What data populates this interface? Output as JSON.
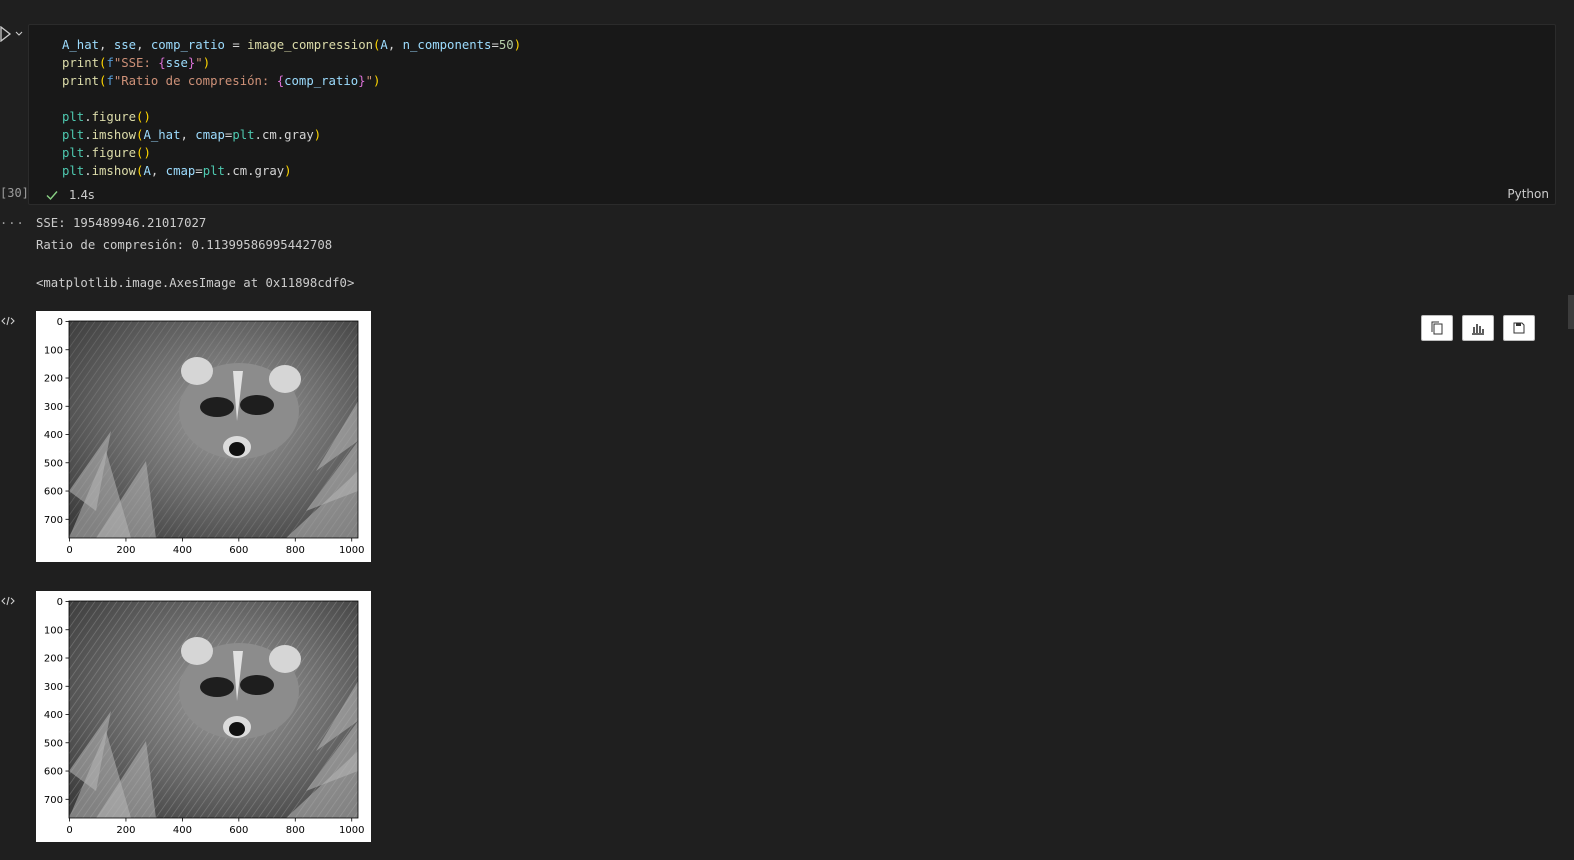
{
  "cell": {
    "execution_count": "[30]",
    "status_time": "1.4s",
    "language": "Python",
    "code_lines": [
      [
        [
          "A_hat",
          "k-var"
        ],
        [
          ", ",
          "k-op"
        ],
        [
          "sse",
          "k-var"
        ],
        [
          ", ",
          "k-op"
        ],
        [
          "comp_ratio",
          "k-var"
        ],
        [
          " = ",
          "k-op"
        ],
        [
          "image_compression",
          "k-fn"
        ],
        [
          "(",
          "k-br1"
        ],
        [
          "A",
          "k-var"
        ],
        [
          ", ",
          "k-op"
        ],
        [
          "n_components",
          "k-var"
        ],
        [
          "=",
          "k-op"
        ],
        [
          "50",
          "k-num"
        ],
        [
          ")",
          "k-br1"
        ]
      ],
      [
        [
          "print",
          "k-fn"
        ],
        [
          "(",
          "k-br1"
        ],
        [
          "f",
          "k-pre"
        ],
        [
          "\"SSE: ",
          "k-str"
        ],
        [
          "{",
          "k-br2"
        ],
        [
          "sse",
          "k-var"
        ],
        [
          "}",
          "k-br2"
        ],
        [
          "\"",
          "k-str"
        ],
        [
          ")",
          "k-br1"
        ]
      ],
      [
        [
          "print",
          "k-fn"
        ],
        [
          "(",
          "k-br1"
        ],
        [
          "f",
          "k-pre"
        ],
        [
          "\"Ratio de compresión: ",
          "k-str"
        ],
        [
          "{",
          "k-br2"
        ],
        [
          "comp_ratio",
          "k-var"
        ],
        [
          "}",
          "k-br2"
        ],
        [
          "\"",
          "k-str"
        ],
        [
          ")",
          "k-br1"
        ]
      ],
      [],
      [
        [
          "plt",
          "k-cls"
        ],
        [
          ".",
          "k-op"
        ],
        [
          "figure",
          "k-fn"
        ],
        [
          "()",
          "k-br1"
        ]
      ],
      [
        [
          "plt",
          "k-cls"
        ],
        [
          ".",
          "k-op"
        ],
        [
          "imshow",
          "k-fn"
        ],
        [
          "(",
          "k-br1"
        ],
        [
          "A_hat",
          "k-var"
        ],
        [
          ", ",
          "k-op"
        ],
        [
          "cmap",
          "k-var"
        ],
        [
          "=",
          "k-op"
        ],
        [
          "plt",
          "k-cls"
        ],
        [
          ".",
          "k-op"
        ],
        [
          "cm",
          "k-op"
        ],
        [
          ".",
          "k-op"
        ],
        [
          "gray",
          "k-op"
        ],
        [
          ")",
          "k-br1"
        ]
      ],
      [
        [
          "plt",
          "k-cls"
        ],
        [
          ".",
          "k-op"
        ],
        [
          "figure",
          "k-fn"
        ],
        [
          "()",
          "k-br1"
        ]
      ],
      [
        [
          "plt",
          "k-cls"
        ],
        [
          ".",
          "k-op"
        ],
        [
          "imshow",
          "k-fn"
        ],
        [
          "(",
          "k-br1"
        ],
        [
          "A",
          "k-var"
        ],
        [
          ", ",
          "k-op"
        ],
        [
          "cmap",
          "k-var"
        ],
        [
          "=",
          "k-op"
        ],
        [
          "plt",
          "k-cls"
        ],
        [
          ".",
          "k-op"
        ],
        [
          "cm",
          "k-op"
        ],
        [
          ".",
          "k-op"
        ],
        [
          "gray",
          "k-op"
        ],
        [
          ")",
          "k-br1"
        ]
      ]
    ]
  },
  "output": {
    "dots": "...",
    "sse_line": "SSE: 195489946.21017027",
    "ratio_line": "Ratio de compresión: 0.11399586995442708",
    "repr_line": "<matplotlib.image.AxesImage at 0x11898cdf0>"
  },
  "figures": [
    {
      "y_ticks": [
        "0",
        "100",
        "200",
        "300",
        "400",
        "500",
        "600",
        "700"
      ],
      "x_ticks": [
        "0",
        "200",
        "400",
        "600",
        "800",
        "1000"
      ],
      "image": "raccoon-grayscale-compressed"
    },
    {
      "y_ticks": [
        "0",
        "100",
        "200",
        "300",
        "400",
        "500",
        "600",
        "700"
      ],
      "x_ticks": [
        "0",
        "200",
        "400",
        "600",
        "800",
        "1000"
      ],
      "image": "raccoon-grayscale-original"
    }
  ],
  "toolbar": {
    "icons": [
      "copy-icon",
      "chart-icon",
      "save-icon"
    ]
  }
}
